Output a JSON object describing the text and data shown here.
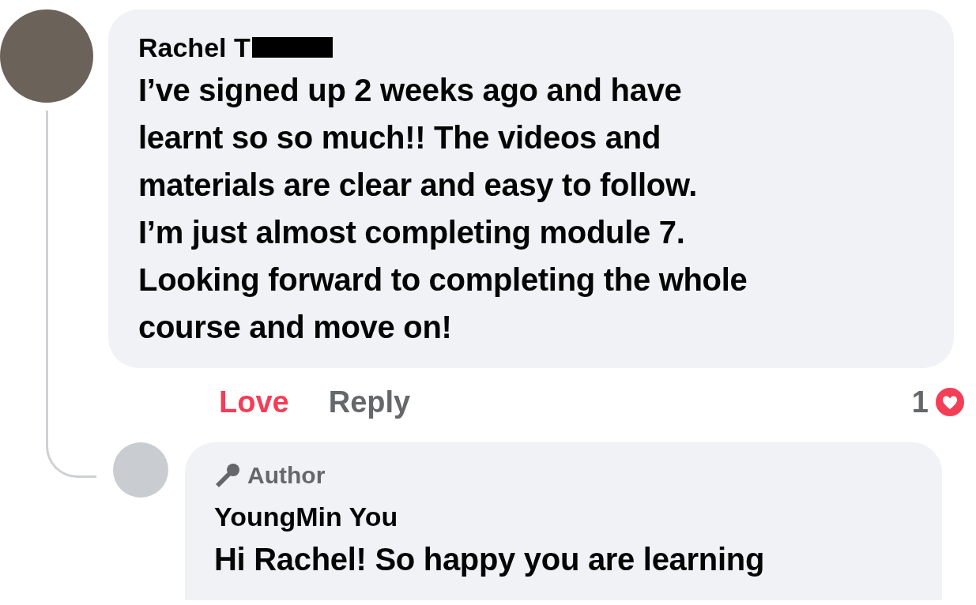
{
  "comment": {
    "author": "Rachel T",
    "text": "I’ve signed up 2 weeks ago and have\nlearnt so so much!! The videos and\nmaterials are clear and easy to follow.\nI’m just almost completing module 7.\nLooking forward to completing the whole\ncourse and move on!",
    "actions": [
      {
        "label": "Love",
        "reacted": true
      },
      {
        "label": "Reply",
        "reacted": false
      }
    ],
    "reaction_count": "1"
  },
  "reply": {
    "badge": "Author",
    "author": "YoungMin You",
    "text": "Hi Rachel! So happy you are learning"
  }
}
